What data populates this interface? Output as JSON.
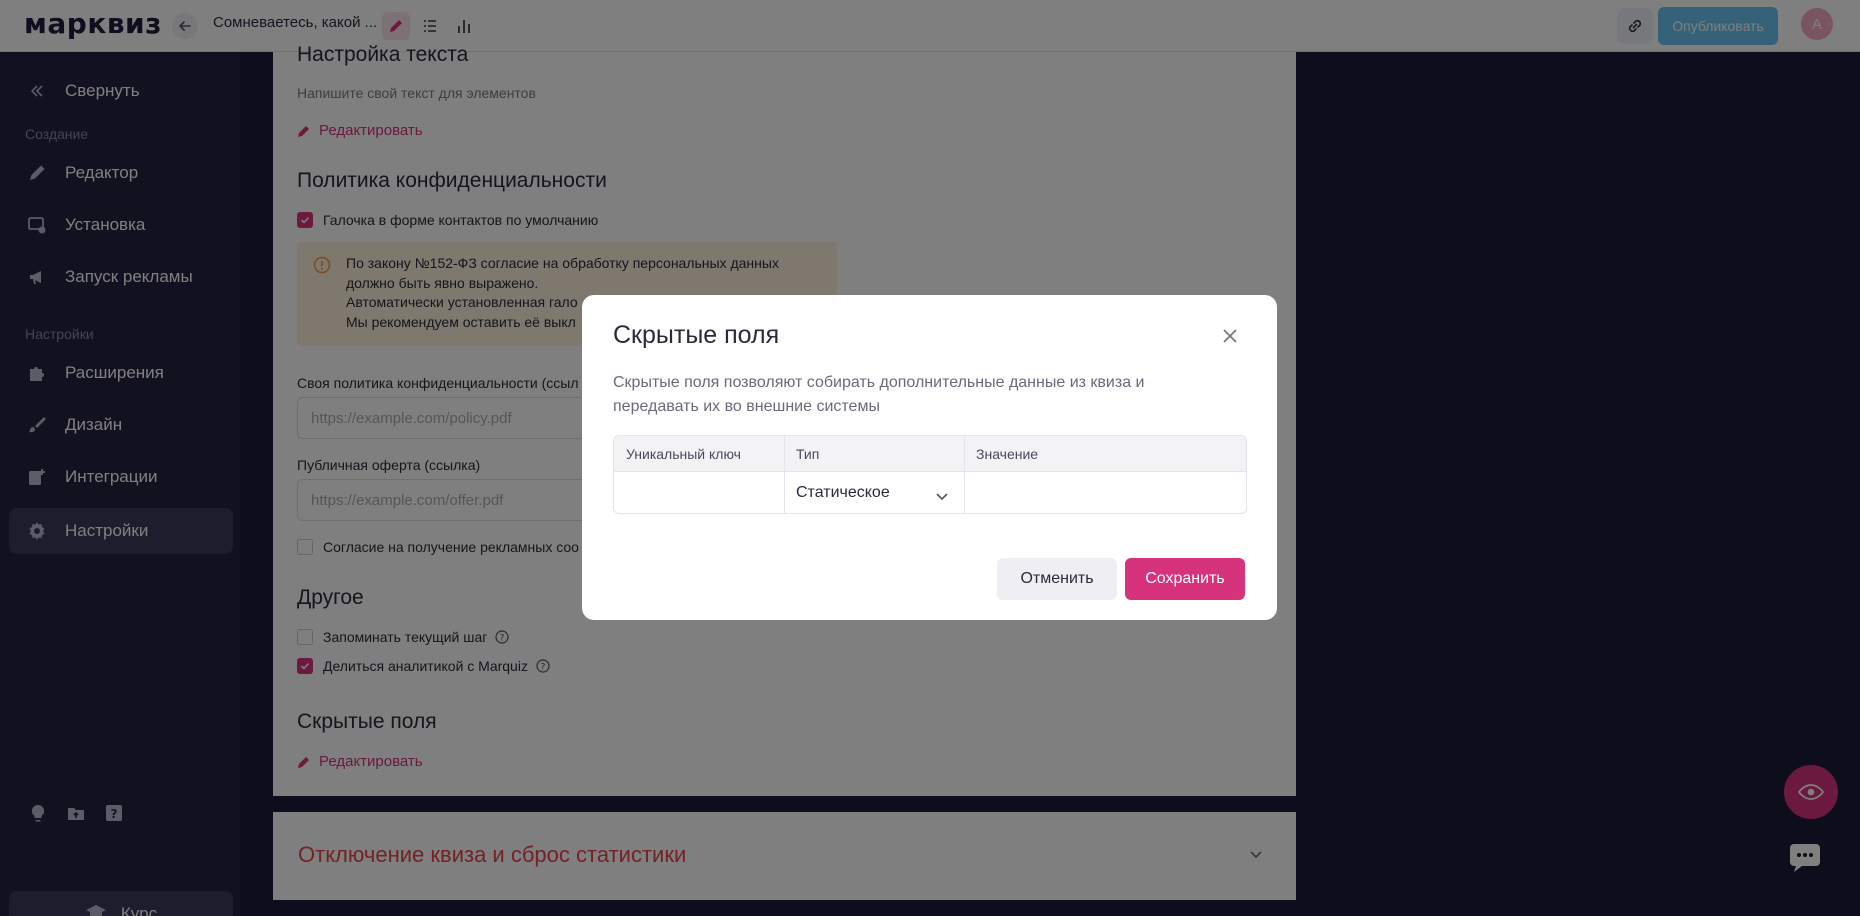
{
  "topbar": {
    "logo": "марквиз",
    "quiz_title": "Сомневаетесь, какой ...",
    "publish_label": "Опубликовать",
    "avatar_letter": "А"
  },
  "sidebar": {
    "collapse_label": "Свернуть",
    "section_create": "Создание",
    "section_settings": "Настройки",
    "items": [
      {
        "label": "Редактор",
        "icon": "pencil-icon"
      },
      {
        "label": "Установка",
        "icon": "install-icon"
      },
      {
        "label": "Запуск рекламы",
        "icon": "megaphone-icon"
      },
      {
        "label": "Расширения",
        "icon": "puzzle-icon"
      },
      {
        "label": "Дизайн",
        "icon": "brush-icon"
      },
      {
        "label": "Интеграции",
        "icon": "integrations-icon"
      },
      {
        "label": "Настройки",
        "icon": "gear-icon",
        "active": true
      }
    ],
    "course_label": "Курс"
  },
  "content": {
    "text_settings_title": "Настройка текста",
    "text_settings_desc": "Напишите свой текст для элементов",
    "edit_label": "Редактировать",
    "privacy_title": "Политика конфиденциальности",
    "privacy_checkbox_label": "Галочка в форме контактов по умолчанию",
    "privacy_checkbox_checked": true,
    "warning_lines": [
      "По закону №152-ФЗ согласие на обработку персональных данных",
      "должно быть явно выражено.",
      "Автоматически установленная гало",
      "Мы рекомендуем оставить её выкл"
    ],
    "own_policy_label": "Своя политика конфиденциальности (ссыл",
    "own_policy_placeholder": "https://example.com/policy.pdf",
    "offer_label": "Публичная оферта (ссылка)",
    "offer_placeholder": "https://example.com/offer.pdf",
    "ads_consent_label": "Согласие на получение рекламных соо",
    "ads_consent_checked": false,
    "other_title": "Другое",
    "remember_step_label": "Запоминать текущий шаг",
    "remember_step_checked": false,
    "share_analytics_label": "Делиться аналитикой с Marquiz",
    "share_analytics_checked": true,
    "hidden_fields_title": "Скрытые поля",
    "hidden_fields_edit": "Редактировать",
    "disable_quiz_title": "Отключение квиза и сброс статистики"
  },
  "modal": {
    "title": "Скрытые поля",
    "description": "Скрытые поля позволяют собирать дополнительные данные из квиза и передавать их во внешние системы",
    "columns": [
      "Уникальный ключ",
      "Тип",
      "Значение"
    ],
    "row": {
      "key": "",
      "type": "Статическое",
      "value": ""
    },
    "cancel_label": "Отменить",
    "save_label": "Сохранить"
  },
  "colors": {
    "accent": "#d6337c",
    "sidebar_bg": "#25233f",
    "publish_bg": "#6cc5f2",
    "danger_text": "#e8454b"
  }
}
